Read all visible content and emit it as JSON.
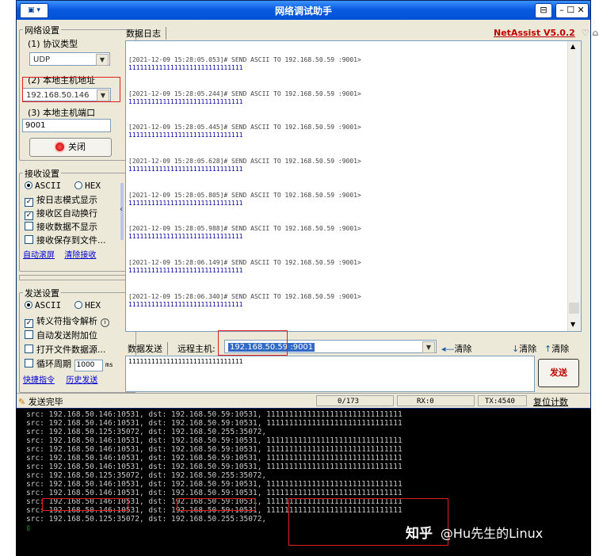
{
  "window": {
    "title": "网络调试助手",
    "brand_link": "NetAssist V5.0.2"
  },
  "network_settings": {
    "legend": "网络设置",
    "protocol_label": "(1) 协议类型",
    "protocol_value": "UDP",
    "local_host_label": "(2) 本地主机地址",
    "local_host_value": "192.168.50.146",
    "local_port_label": "(3) 本地主机端口",
    "local_port_value": "9001",
    "close_button": "关闭"
  },
  "receive_settings": {
    "legend": "接收设置",
    "ascii": "ASCII",
    "hex": "HEX",
    "options": [
      {
        "label": "按日志模式显示",
        "checked": true
      },
      {
        "label": "接收区自动换行",
        "checked": true
      },
      {
        "label": "接收数据不显示",
        "checked": false
      },
      {
        "label": "接收保存到文件...",
        "checked": false
      }
    ],
    "auto_scroll": "自动滚屏",
    "clear_receive": "清除接收"
  },
  "send_settings": {
    "legend": "发送设置",
    "ascii": "ASCII",
    "hex": "HEX",
    "escape_option": "转义符指令解析",
    "auto_append": "自动发送附加位",
    "open_file": "打开文件数据源...",
    "cycle_label": "循环周期",
    "cycle_value": "1000",
    "cycle_unit": "ms",
    "shortcut": "快捷指令",
    "history": "历史发送"
  },
  "log_panel": {
    "tab": "数据日志",
    "entries": [
      {
        "timestamp": "[2021-12-09 15:28:05.053]# SEND ASCII TO 192.168.50.59 :9001>",
        "data": "111111111111111111111111111111"
      },
      {
        "timestamp": "[2021-12-09 15:28:05.244]# SEND ASCII TO 192.168.50.59 :9001>",
        "data": "111111111111111111111111111111"
      },
      {
        "timestamp": "[2021-12-09 15:28:05.445]# SEND ASCII TO 192.168.50.59 :9001>",
        "data": "111111111111111111111111111111"
      },
      {
        "timestamp": "[2021-12-09 15:28:05.628]# SEND ASCII TO 192.168.50.59 :9001>",
        "data": "111111111111111111111111111111"
      },
      {
        "timestamp": "[2021-12-09 15:28:05.805]# SEND ASCII TO 192.168.50.59 :9001>",
        "data": "111111111111111111111111111111"
      },
      {
        "timestamp": "[2021-12-09 15:28:05.988]# SEND ASCII TO 192.168.50.59 :9001>",
        "data": "111111111111111111111111111111"
      },
      {
        "timestamp": "[2021-12-09 15:28:06.149]# SEND ASCII TO 192.168.50.59 :9001>",
        "data": "111111111111111111111111111111"
      },
      {
        "timestamp": "[2021-12-09 15:28:06.340]# SEND ASCII TO 192.168.50.59 :9001>",
        "data": "111111111111111111111111111111"
      }
    ]
  },
  "send_bar": {
    "tab": "数据发送",
    "remote_label": "远程主机:",
    "remote_value": "192.168.50.59 :9001",
    "clear1": "清除",
    "clear2": "清除",
    "clear3": "清除",
    "send_text": "111111111111111111111111111111",
    "send_button": "发送"
  },
  "status_bar": {
    "message": "发送完毕",
    "count": "0/173",
    "rx": "RX:0",
    "tx": "TX:4540",
    "reset": "复位计数"
  },
  "terminal": {
    "lines": [
      "src: 192.168.50.146:10531, dst: 192.168.50.59:10531, 111111111111111111111111111111",
      "src: 192.168.50.146:10531, dst: 192.168.50.59:10531, 111111111111111111111111111111",
      "src: 192.168.50.125:35072, dst: 192.168.50.255:35072,",
      "src: 192.168.50.146:10531, dst: 192.168.50.59:10531, 111111111111111111111111111111",
      "src: 192.168.50.146:10531, dst: 192.168.50.59:10531, 111111111111111111111111111111",
      "src: 192.168.50.146:10531, dst: 192.168.50.59:10531, 111111111111111111111111111111",
      "src: 192.168.50.146:10531, dst: 192.168.50.59:10531, 111111111111111111111111111111",
      "src: 192.168.50.125:35072, dst: 192.168.50.255:35072,",
      "src: 192.168.50.146:10531, dst: 192.168.50.59:10531, 111111111111111111111111111111",
      "src: 192.168.50.146:10531, dst: 192.168.50.59:10531, 111111111111111111111111111111",
      "src: 192.168.50.146:10531, dst: 192.168.50.59:10531, 111111111111111111111111111111",
      "src: 192.168.50.146:10531, dst: 192.168.50.59:10531, 111111111111111111111111111111",
      "src: 192.168.50.125:35072, dst: 192.168.50.255:35072,"
    ],
    "prompt": "▯"
  },
  "watermark": {
    "site": "知乎",
    "author": "@Hu先生的Linux"
  }
}
